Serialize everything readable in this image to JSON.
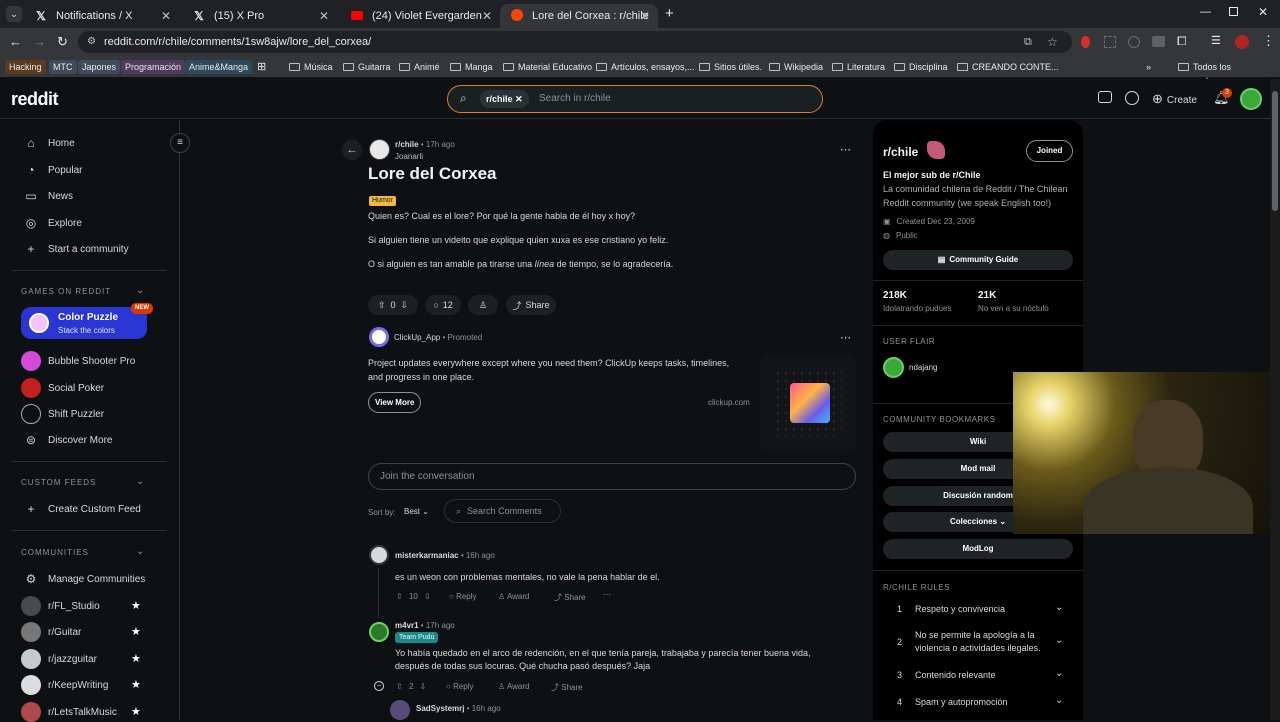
{
  "tabs": [
    {
      "title": "Notifications / X",
      "icon": "x-logo-icon"
    },
    {
      "title": "(15) X Pro",
      "icon": "x-logo-icon"
    },
    {
      "title": "(24) Violet Evergarden OST: Au",
      "icon": "youtube-icon"
    },
    {
      "title": "Lore del Corxea : r/chile",
      "icon": "reddit-icon"
    }
  ],
  "url": "reddit.com/r/chile/comments/1sw8ajw/lore_del_corxea/",
  "bookmarks": {
    "chips": [
      "Hacking",
      "MTC",
      "Japones",
      "Programación",
      "Anime&Manga"
    ],
    "folders": [
      "Música",
      "Guitarra",
      "Animé",
      "Manga",
      "Material Educativo",
      "Artículos, ensayos,...",
      "Sitios útiles.",
      "Wikipedia",
      "Literatura",
      "Disciplina",
      "CREANDO CONTE..."
    ],
    "all": "Todos los marcadores"
  },
  "header": {
    "logo": "reddit",
    "search_chip": "r/chile",
    "search_placeholder": "Search in r/chile",
    "create": "Create",
    "notif_count": "3"
  },
  "sidebar": {
    "nav": [
      "Home",
      "Popular",
      "News",
      "Explore",
      "Start a community"
    ],
    "games_head": "GAMES ON REDDIT",
    "featured_game": {
      "title": "Color Puzzle",
      "sub": "Stack the colors",
      "badge": "NEW"
    },
    "games": [
      "Bubble Shooter Pro",
      "Social Poker",
      "Shift Puzzler",
      "Discover More"
    ],
    "custom_head": "CUSTOM FEEDS",
    "create_feed": "Create Custom Feed",
    "communities_head": "COMMUNITIES",
    "manage": "Manage Communities",
    "communities": [
      "r/FL_Studio",
      "r/Guitar",
      "r/jazzguitar",
      "r/KeepWriting",
      "r/LetsTalkMusic"
    ]
  },
  "post": {
    "subreddit": "r/chile",
    "time": "17h ago",
    "author": "Joanarli",
    "title": "Lore del Corxea",
    "flair": "Humor",
    "body1": "Quien es? Cual es el lore? Por qué la gente habla de él hoy x hoy?",
    "body2": "Si alguien tiene un videito que explique quien xuxa es ese cristiano yo feliz.",
    "body3a": "O si alguien es tan amable pa tirarse una ",
    "body3b": "línea",
    "body3c": " de tiempo, se lo agradecería.",
    "votes": "0",
    "comments": "12",
    "share": "Share"
  },
  "ad": {
    "name": "ClickUp_App",
    "promoted": "Promoted",
    "text1": "Project updates everywhere except where you need them? ClickUp keeps tasks, timelines,",
    "text2": "and progress in one place.",
    "cta": "View More",
    "domain": "clickup.com"
  },
  "comments_area": {
    "join": "Join the conversation",
    "sort_label": "Sort by:",
    "sort_value": "Best",
    "search": "Search Comments"
  },
  "comments": [
    {
      "author": "misterkarmaniac",
      "time": "16h ago",
      "text": "es un weon con problemas mentales, no vale la pena hablar de el.",
      "votes": "10"
    },
    {
      "author": "m4vr1",
      "time": "17h ago",
      "flair": "Team Pudú",
      "text1": "Yo había quedado en el arco de redención, en el que tenía pareja, trabajaba y parecía tener buena vida,",
      "text2": "después de todas sus locuras. Qué chucha pasó después? Jaja",
      "votes": "2"
    },
    {
      "author": "SadSystemrj",
      "time": "16h ago"
    }
  ],
  "comment_actions": {
    "reply": "Reply",
    "award": "Award",
    "share": "Share"
  },
  "community": {
    "name": "r/chile",
    "joined": "Joined",
    "tagline": "El mejor sub de r/Chile",
    "desc1": "La comunidad chilena de Reddit / The Chilean",
    "desc2": "Reddit community (we speak English too!)",
    "created": "Created Dec 23, 2009",
    "visibility": "Public",
    "guide": "Community Guide",
    "members": "218K",
    "members_label": "Idolatrando pudúes",
    "online": "21K",
    "online_label": "No ven a su nóctulo",
    "flair_head": "USER FLAIR",
    "flair_user": "ndajang",
    "bookmarks_head": "COMMUNITY BOOKMARKS",
    "bookmarks": [
      "Wiki",
      "Mod mail",
      "Discusión random",
      "Colecciones",
      "ModLog"
    ],
    "rules_head": "R/CHILE RULES",
    "rules": [
      {
        "n": "1",
        "text": "Respeto y convivencia"
      },
      {
        "n": "2",
        "text": "No se permite la apología a la",
        "text2": "violencia o actividades ilegales."
      },
      {
        "n": "3",
        "text": "Contenido relevante"
      },
      {
        "n": "4",
        "text": "Spam y autopromoción"
      }
    ]
  },
  "colors": {
    "accent": "#d93a00",
    "upvote": "#ff4500",
    "brand_blue": "#0045ac",
    "flair_yellow": "#f2b73d"
  }
}
